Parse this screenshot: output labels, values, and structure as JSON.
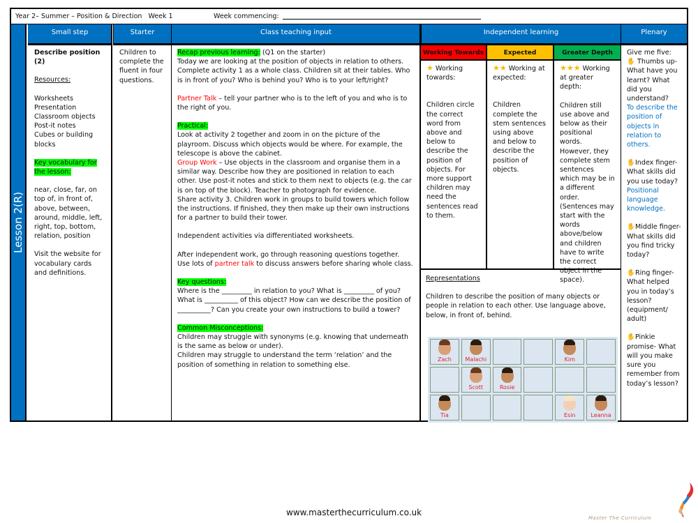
{
  "header": {
    "title": "Year 2– Summer – Position & Direction   Week 1",
    "week_commencing_label": "Week commencing:"
  },
  "lesson_label": "Lesson 2(R)",
  "columns": {
    "small_step": "Small step",
    "starter": "Starter",
    "class_teaching": "Class teaching input",
    "independent": "Independent learning",
    "plenary": "Plenary"
  },
  "small_step": {
    "title": "Describe position (2)",
    "resources_label": "Resources:",
    "resources": [
      "Worksheets",
      "Presentation",
      "Classroom objects",
      "Post-it notes",
      "Cubes or building blocks"
    ],
    "vocab_label": "Key vocabulary for the lesson:",
    "vocab": "near, close, far, on top of, in front of, above, between, around, middle, left, right, top, bottom, relation, position",
    "website_note": "Visit the website for vocabulary cards and definitions."
  },
  "starter": {
    "text": "Children to complete the fluent in four questions."
  },
  "teaching": {
    "recap_label": "Recap previous learning:",
    "recap_note": " (Q1 on the starter)",
    "intro_1": "Today we are looking at the position of objects in relation to others.",
    "intro_2": "Complete activity 1 as a whole class. Children sit at their tables. Who is in front of you? Who is behind you? Who is to your left/right?",
    "partner_talk_label": "Partner Talk",
    "partner_talk_text": " – tell your partner who is to the left of you and who is to the right of you.",
    "practical_label": "Practical:",
    "practical_text": "Look at activity 2 together and zoom in on the picture of the playroom. Discuss which objects would be where. For example, the telescope is above the cabinet.",
    "group_work_label": "Group Work",
    "group_work_text": " – Use objects in the classroom and organise them in a similar way. Describe how they are positioned in relation to each other. Use post-it notes and stick to them next to objects (e.g. the car is on top of the block). Teacher to photograph for evidence.",
    "share_text": "Share activity 3. Children work in groups to build towers which follow the instructions. If finished, they then make up their own instructions for a partner to build their tower.",
    "independent_text": "Independent activities via differentiated worksheets.",
    "after_text_1": "After independent work, go through reasoning questions together. Use lots of ",
    "after_partner_talk": "partner talk",
    "after_text_2": " to discuss answers before sharing whole class.",
    "key_questions_label": "Key questions:",
    "key_questions_text": "Where is the _________ in relation to you? What is _________ of you? What is __________ of this object? How can we describe the position of __________? Can you create your own instructions to build a tower?",
    "misconceptions_label": "Common Misconceptions:",
    "misconception_1": "Children may struggle with synonyms (e.g. knowing that underneath is the same as below or under).",
    "misconception_2": "Children may struggle to understand the term ‘relation’ and the position of something in relation to something else."
  },
  "independent": {
    "levels": [
      {
        "label": "Working Towards",
        "color": "#ff0000",
        "stars": "★",
        "heading": " Working towards:",
        "text": "Children circle the correct word from above and below to describe the position of objects. For more support children may need the sentences read to them."
      },
      {
        "label": "Expected",
        "color": "#ffc000",
        "stars": "★★",
        "heading": " Working at expected:",
        "text": "Children complete the stem sentences using above and below to describe the position of objects."
      },
      {
        "label": "Greater Depth",
        "color": "#00b050",
        "stars": "★★★",
        "heading": " Working at greater depth:",
        "text": "Children still use above and below as their positional words. However, they complete stem sentences which may be in a different order. (Sentences may start with the words above/below and children have to write the correct object in the space)."
      }
    ],
    "representations_label": "Representations",
    "representations_text": "Children to describe the position of many objects or people in relation to each other. Use language above, below, in front of, behind.",
    "grid": [
      [
        "Zach",
        "Malachi",
        "",
        "",
        "Kim",
        ""
      ],
      [
        "",
        "Scott",
        "Rosie",
        "",
        "",
        ""
      ],
      [
        "Tia",
        "",
        "",
        "",
        "Esin",
        "Leanna"
      ]
    ]
  },
  "plenary": {
    "intro": "Give me five:",
    "items": [
      {
        "lead": " Thumbs up- What have you learnt? What did you understand?",
        "answer": "To describe the position of objects in relation to others."
      },
      {
        "lead": "Index finger- What skills did you use today?",
        "answer": "Positional language knowledge."
      },
      {
        "lead": "Middle finger- What skills did you find tricky today?",
        "answer": ""
      },
      {
        "lead": "Ring finger- What helped you in today’s lesson? (equipment/ adult)",
        "answer": ""
      },
      {
        "lead": "Pinkie promise- What will you make sure you remember from today’s lesson?",
        "answer": ""
      }
    ]
  },
  "footer": {
    "url": "www.masterthecurriculum.co.uk",
    "logo_text": "Master The Curriculum"
  },
  "colors": {
    "header_blue": "#0070c0",
    "highlight_green": "#00ff00",
    "accent_red": "#ff0000",
    "answer_blue": "#0070c0"
  }
}
